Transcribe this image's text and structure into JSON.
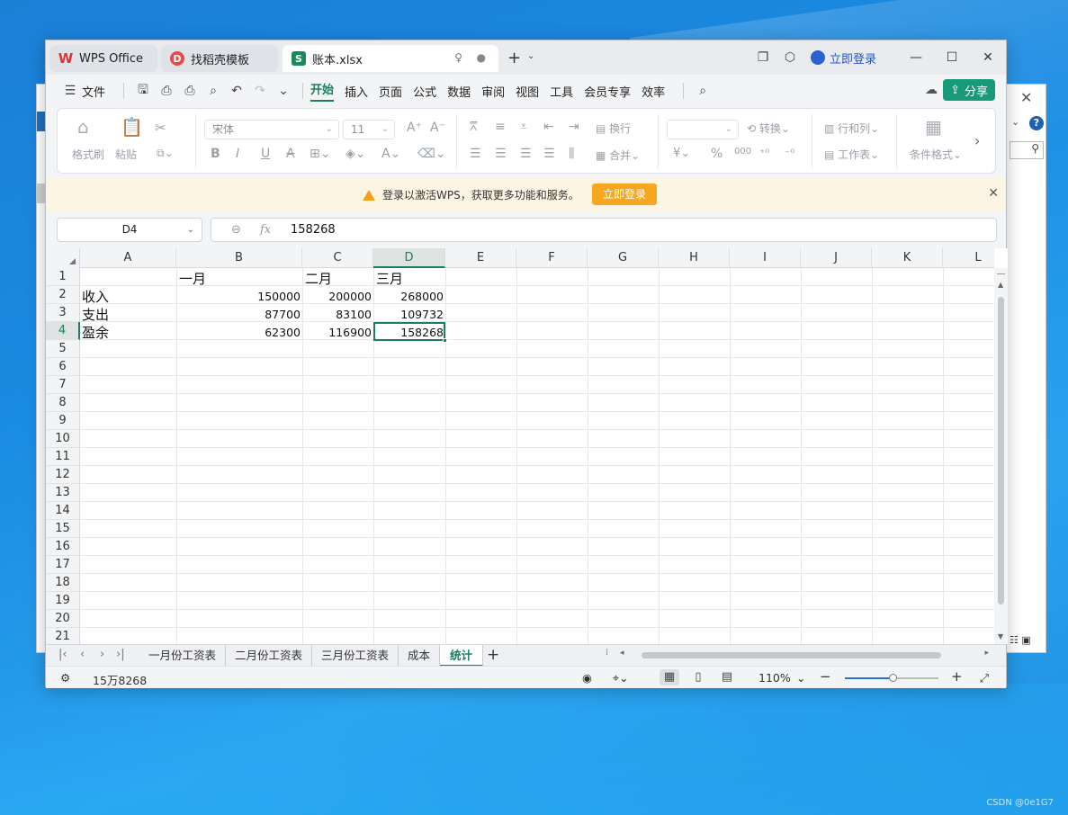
{
  "tabs": [
    {
      "label": "WPS Office"
    },
    {
      "label": "找稻壳模板"
    },
    {
      "label": "账本.xlsx"
    }
  ],
  "titlebar": {
    "login": "立即登录"
  },
  "menu": {
    "file": "文件",
    "items": [
      "开始",
      "插入",
      "页面",
      "公式",
      "数据",
      "审阅",
      "视图",
      "工具",
      "会员专享",
      "效率"
    ],
    "share": "分享"
  },
  "ribbon": {
    "format_painter": "格式刷",
    "paste": "粘贴",
    "font": "宋体",
    "size": "11",
    "wrap": "换行",
    "merge": "合并",
    "convert": "转换",
    "rows_cols": "行和列",
    "worksheet": "工作表",
    "cond_format": "条件格式",
    "percent": "%",
    "thousands": "000"
  },
  "notice": {
    "text": "登录以激活WPS，获取更多功能和服务。",
    "button": "立即登录"
  },
  "formula": {
    "cell_ref": "D4",
    "fx": "fx",
    "value": "158268"
  },
  "columns": [
    "A",
    "B",
    "C",
    "D",
    "E",
    "F",
    "G",
    "H",
    "I",
    "J",
    "K",
    "L"
  ],
  "rows": [
    "1",
    "2",
    "3",
    "4",
    "5",
    "6",
    "7",
    "8",
    "9",
    "10",
    "11",
    "12",
    "13",
    "14",
    "15",
    "16",
    "17",
    "18",
    "19",
    "20",
    "21"
  ],
  "cells": {
    "b1": "一月",
    "c1": "二月",
    "d1": "三月",
    "a2": "收入",
    "b2": "150000",
    "c2": "200000",
    "d2": "268000",
    "a3": "支出",
    "b3": "87700",
    "c3": "83100",
    "d3": "109732",
    "a4": "盈余",
    "b4": "62300",
    "c4": "116900",
    "d4": "158268"
  },
  "sheets": [
    "一月份工资表",
    "二月份工资表",
    "三月份工资表",
    "成本",
    "统计"
  ],
  "status": {
    "sum": "15万8268",
    "zoom": "110%"
  },
  "watermark": "CSDN @0e1G7"
}
